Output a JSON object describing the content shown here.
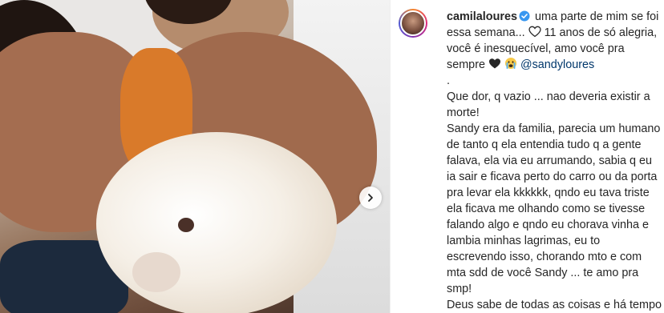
{
  "post": {
    "username": "camilaloures",
    "intro_text_1": "uma parte de mim se foi essa semana...",
    "intro_text_2": "11 anos de só alegria, você é inesquecível, amo você pra sempre",
    "mention": "@sandyloures",
    "separator": ".",
    "paragraph_1": "Que dor, q vazio ... nao deveria existir a morte!",
    "paragraph_2": "Sandy era da familia, parecia um humano de tanto q ela entendia tudo q a gente falava, ela via eu arrumando, sabia q eu ia sair e ficava perto do carro ou da porta pra levar ela kkkkkk, qndo eu tava triste ela ficava me olhando como se tivesse falando algo e qndo eu chorava vinha e lambia minhas lagrimas, eu to escrevendo isso, chorando mto e com mta sdd de você Sandy ... te amo pra smp!",
    "paragraph_3": "Deus sabe de todas as coisas e há tempo"
  },
  "icons": {
    "verified": "verified-badge-icon",
    "heart_outline": "heart-outline-icon",
    "black_heart": "black-heart-emoji",
    "crying_face": "crying-face-emoji",
    "next": "chevron-right-icon"
  },
  "colors": {
    "verified": "#3897f0",
    "mention": "#00376b",
    "text": "#262626"
  }
}
